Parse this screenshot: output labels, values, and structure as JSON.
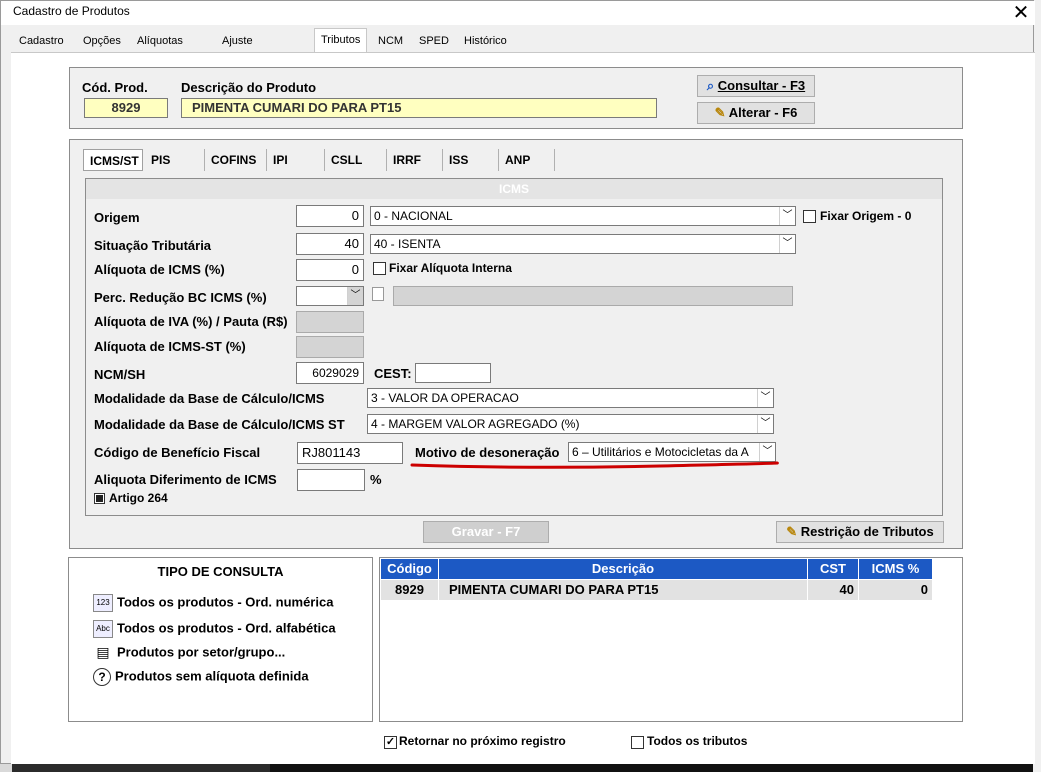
{
  "window": {
    "title": "Cadastro de Produtos",
    "close_glyph": "✕"
  },
  "tabs": [
    {
      "label": "Cadastro"
    },
    {
      "label": "Opções"
    },
    {
      "label": "Alíquotas ECF"
    },
    {
      "label": "Ajuste de Preços"
    },
    {
      "label": "Tributos"
    },
    {
      "label": "NCM"
    },
    {
      "label": "SPED"
    },
    {
      "label": "Histórico"
    }
  ],
  "product": {
    "code_label": "Cód. Prod.",
    "code": "8929",
    "desc_label": "Descrição do Produto",
    "desc": "PIMENTA CUMARI DO PARA PT15"
  },
  "buttons": {
    "consultar": "Consultar - F3",
    "alterar": "Alterar - F6",
    "gravar": "Gravar - F7",
    "restricao": "Restrição de Tributos"
  },
  "tax_tabs": [
    {
      "label": "ICMS/ST"
    },
    {
      "label": "PIS"
    },
    {
      "label": "COFINS"
    },
    {
      "label": "IPI"
    },
    {
      "label": "CSLL"
    },
    {
      "label": "IRRF"
    },
    {
      "label": "ISS"
    },
    {
      "label": "ANP"
    }
  ],
  "icms": {
    "header": "ICMS",
    "origem_label": "Origem",
    "origem_value": "0",
    "origem_select": "0 - NACIONAL",
    "fixar_origem": "Fixar Origem - 0",
    "situacao_label": "Situação Tributária",
    "situacao_value": "40",
    "situacao_select": "40 - ISENTA",
    "aliquota_label": "Alíquota de ICMS (%)",
    "aliquota_value": "0",
    "fixar_aliquota": "Fixar Alíquota Interna",
    "perc_reducao_label": "Perc. Redução BC ICMS (%)",
    "aliq_iva_label": "Alíquota de IVA (%) / Pauta (R$)",
    "aliq_st_label": "Alíquota de ICMS-ST (%)",
    "ncm_label": "NCM/SH",
    "ncm_value": "6029029",
    "cest_label": "CEST:",
    "cest_value": "",
    "mod_bc_label": "Modalidade da Base de Cálculo/ICMS",
    "mod_bc_value": "3 - VALOR DA OPERACAO",
    "mod_bc_st_label": "Modalidade da Base de Cálculo/ICMS ST",
    "mod_bc_st_value": "4 - MARGEM VALOR AGREGADO (%)",
    "beneficio_label": "Código de Benefício Fiscal",
    "beneficio_value": "RJ801143",
    "motivo_label": "Motivo de desoneração",
    "motivo_value": "6 – Utilitários e Motocicletas da A",
    "diferimento_label": "Aliquota Diferimento de ICMS",
    "diferimento_value": "",
    "percent_sign": "%",
    "artigo_label": "Artigo 264"
  },
  "consulta": {
    "title": "TIPO DE CONSULTA",
    "items": [
      {
        "label": "Todos os produtos - Ord. numérica",
        "icon": "123"
      },
      {
        "label": "Todos os produtos - Ord. alfabética",
        "icon": "Abc"
      },
      {
        "label": "Produtos por setor/grupo...",
        "icon": "▤"
      },
      {
        "label": "Produtos sem alíquota definida",
        "icon": "?"
      }
    ]
  },
  "table": {
    "headers": [
      "Código",
      "Descrição",
      "CST",
      "ICMS %"
    ],
    "rows": [
      {
        "codigo": "8929",
        "descricao": "PIMENTA CUMARI DO PARA PT15",
        "cst": "40",
        "icms": "0"
      }
    ]
  },
  "footer": {
    "retornar": "Retornar no próximo registro",
    "todos_tributos": "Todos os tributos"
  },
  "colors": {
    "accent": "#1c59c4",
    "highlight": "#cc0000",
    "field_yellow": "#ffffc0"
  }
}
